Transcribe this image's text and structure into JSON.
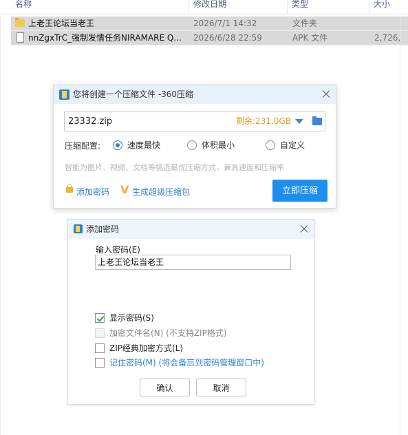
{
  "file_list": {
    "columns": [
      "名称",
      "修改日期",
      "类型",
      "大小"
    ],
    "rows": [
      {
        "name": "上老王论坛当老王",
        "date": "2026/7/1 14:32",
        "type": "文件夹",
        "size": "",
        "icon": "folder-icon"
      },
      {
        "name": "nnZgxTrC_强制发情任务NIRAMARE Q...",
        "date": "2026/6/28 22:59",
        "type": "APK 文件",
        "size": "2,726,",
        "icon": "file-icon"
      }
    ]
  },
  "compress_dialog": {
    "title": "您将创建一个压缩文件 -360压缩",
    "filename": "23332.zip",
    "remaining": "剩余:231.0GB",
    "config_label": "压缩配置:",
    "options": [
      "速度最快",
      "体积最小",
      "自定义"
    ],
    "selected_option": "速度最快",
    "hint": "智能为图片、视频、文档等挑选最优压缩方式，兼具速度和压缩率",
    "add_password_link": "添加密码",
    "super_package_link": "生成超级压缩包",
    "compress_button": "立即压缩",
    "accent_color": "#1e8ff0"
  },
  "password_dialog": {
    "title": "添加密码",
    "input_label": "输入密码(E)",
    "password_value": "上老王论坛当老王",
    "checkboxes": [
      {
        "label": "显示密码(S)",
        "checked": true,
        "enabled": true
      },
      {
        "label": "加密文件名(N) (不支持ZIP格式)",
        "checked": false,
        "enabled": false
      },
      {
        "label": "ZIP经典加密方式(L)",
        "checked": false,
        "enabled": true
      },
      {
        "label": "记住密码(M) (将会备忘到密码管理窗口中)",
        "checked": false,
        "enabled": true
      }
    ],
    "ok_button": "确认",
    "cancel_button": "取消"
  }
}
